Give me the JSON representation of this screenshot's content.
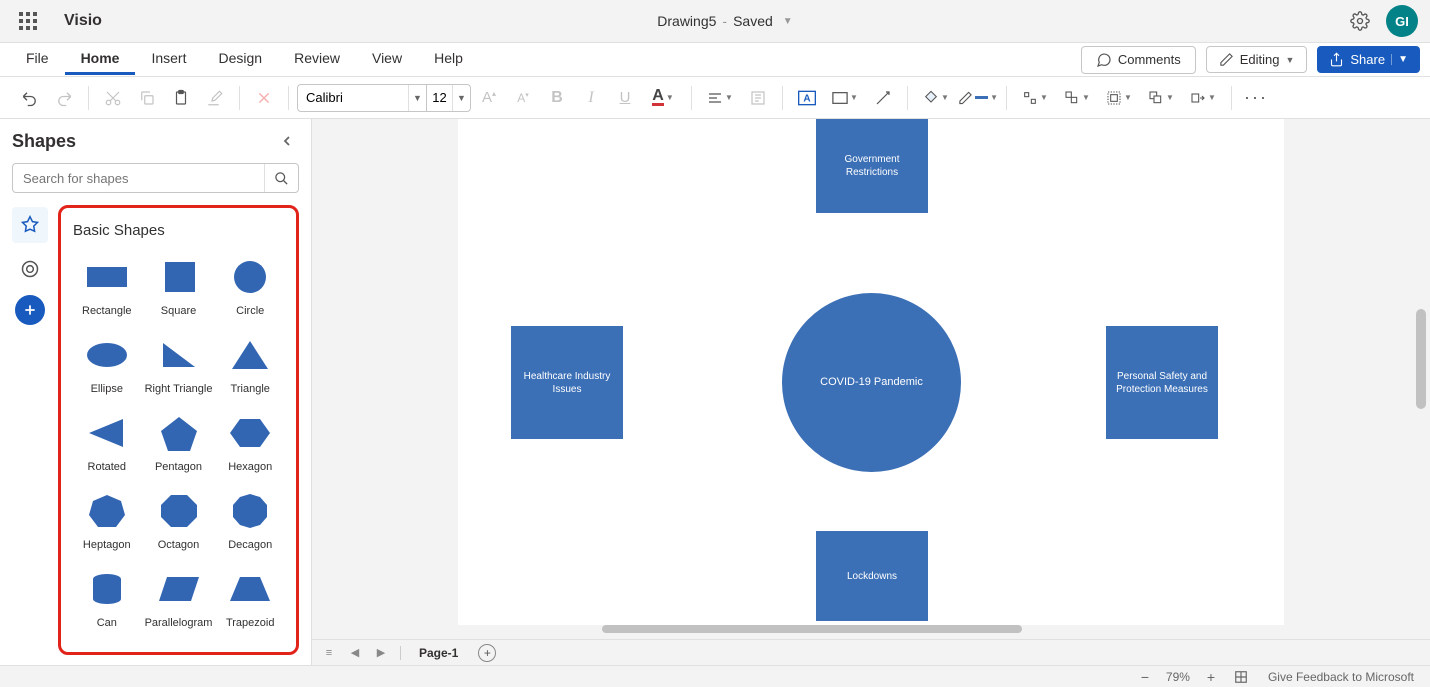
{
  "titlebar": {
    "app_name": "Visio",
    "doc_name": "Drawing5",
    "doc_status": "Saved",
    "avatar_initials": "GI"
  },
  "tabs": [
    "File",
    "Home",
    "Insert",
    "Design",
    "Review",
    "View",
    "Help"
  ],
  "active_tab": "Home",
  "actions": {
    "comments_label": "Comments",
    "editing_label": "Editing",
    "share_label": "Share"
  },
  "toolbar": {
    "font_name": "Calibri",
    "font_size": "12"
  },
  "shapes_panel": {
    "title": "Shapes",
    "search_placeholder": "Search for shapes",
    "group_title": "Basic Shapes",
    "shapes": [
      "Rectangle",
      "Square",
      "Circle",
      "Ellipse",
      "Right Triangle",
      "Triangle",
      "Rotated",
      "Pentagon",
      "Hexagon",
      "Heptagon",
      "Octagon",
      "Decagon",
      "Can",
      "Parallelogram",
      "Trapezoid"
    ]
  },
  "canvas": {
    "shapes": {
      "top": "Government Restrictions",
      "left": "Healthcare Industry Issues",
      "center": "COVID-19 Pandemic",
      "right": "Personal Safety and Protection Measures",
      "bottom": "Lockdowns"
    }
  },
  "page_tabs": {
    "page_label": "Page-1"
  },
  "statusbar": {
    "zoom": "79%",
    "feedback": "Give Feedback to Microsoft"
  }
}
